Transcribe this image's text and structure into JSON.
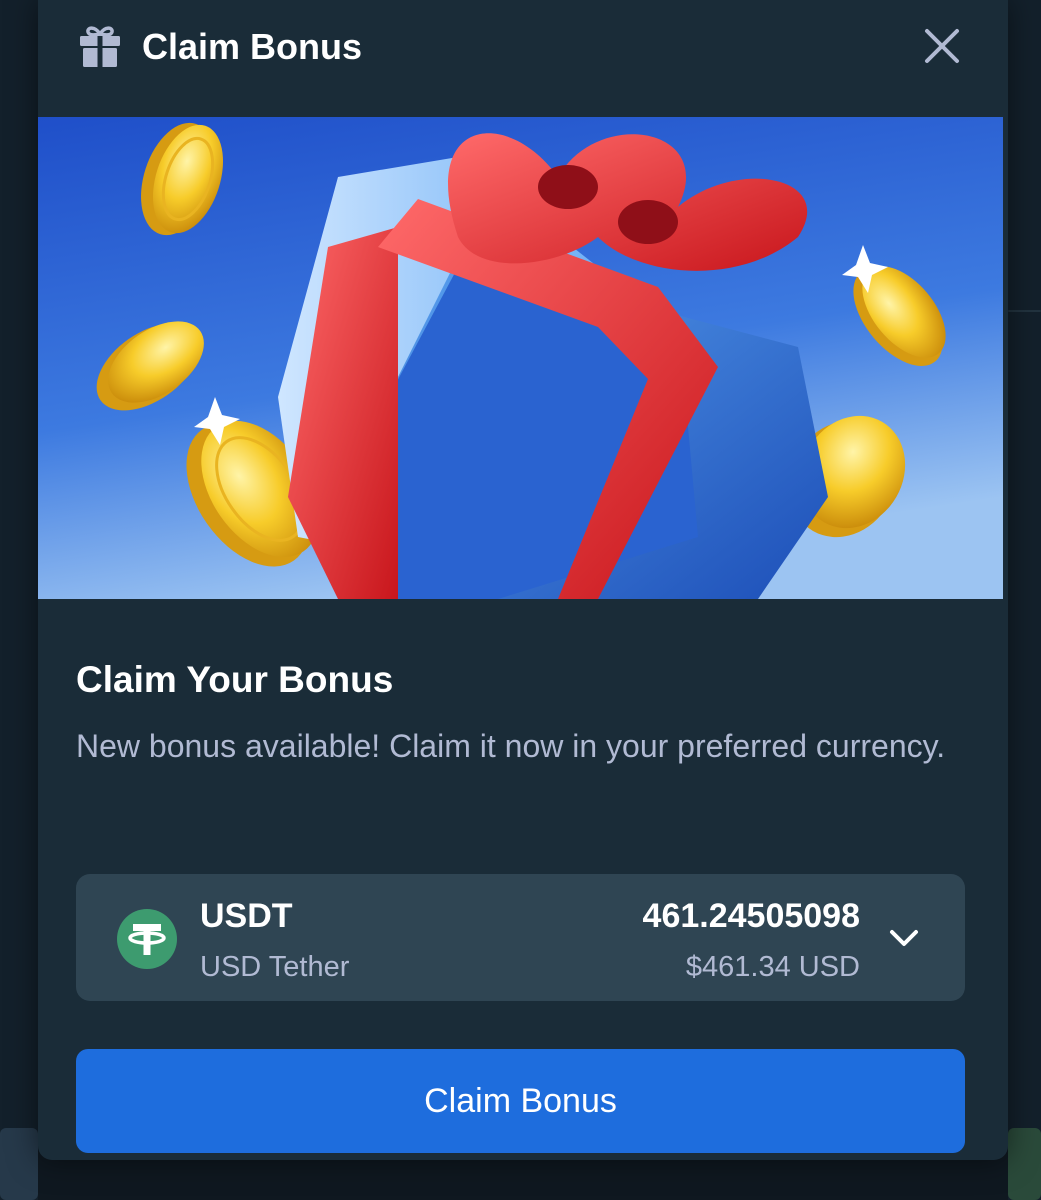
{
  "modal": {
    "title": "Claim Bonus",
    "header_icon": "gift-icon",
    "close_icon": "close-icon"
  },
  "banner": {
    "image": "gift-box-with-gold-coins-illustration"
  },
  "content": {
    "title": "Claim Your Bonus",
    "description": "New bonus available! Claim it now in your preferred currency."
  },
  "currency": {
    "code": "USDT",
    "name": "USD Tether",
    "amount": "461.24505098",
    "usd_value": "$461.34 USD",
    "icon": "tether-icon",
    "dropdown_icon": "chevron-down-icon"
  },
  "actions": {
    "claim_label": "Claim Bonus"
  },
  "colors": {
    "modal_bg": "#1a2c38",
    "select_bg": "#2f4553",
    "button": "#1e6ddd",
    "tether": "#3d9b6f",
    "muted_text": "#b1bad3"
  }
}
